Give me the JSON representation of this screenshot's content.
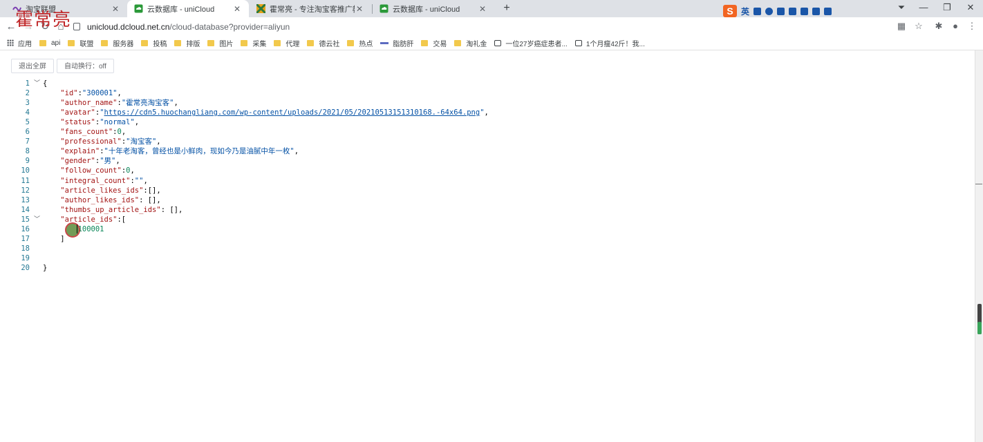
{
  "tabs": [
    {
      "title": "淘宝联盟",
      "active": false
    },
    {
      "title": "云数据库 - uniCloud",
      "active": true
    },
    {
      "title": "霍常亮 - 专注淘宝客推广教程分享",
      "active": false
    },
    {
      "title": "云数据库 - uniCloud",
      "active": false
    }
  ],
  "watermark": "霍常亮",
  "ime": {
    "label": "英"
  },
  "address": {
    "host": "unicloud.dcloud.net.cn",
    "path": "/cloud-database?provider=aliyun"
  },
  "bookmarks": [
    {
      "label": "应用",
      "icon": "apps-icon"
    },
    {
      "label": "api",
      "icon": "folder-icon"
    },
    {
      "label": "联盟",
      "icon": "folder-icon"
    },
    {
      "label": "服务器",
      "icon": "folder-icon"
    },
    {
      "label": "投稿",
      "icon": "folder-icon"
    },
    {
      "label": "排版",
      "icon": "folder-icon"
    },
    {
      "label": "图片",
      "icon": "folder-icon"
    },
    {
      "label": "采集",
      "icon": "folder-icon"
    },
    {
      "label": "代理",
      "icon": "folder-icon"
    },
    {
      "label": "德云社",
      "icon": "folder-icon"
    },
    {
      "label": "热点",
      "icon": "folder-icon"
    },
    {
      "label": "脂肪肝",
      "icon": "bar-icon"
    },
    {
      "label": "交易",
      "icon": "folder-icon"
    },
    {
      "label": "淘礼金",
      "icon": "folder-icon"
    },
    {
      "label": "一位27岁癌症患者...",
      "icon": "calendar-icon"
    },
    {
      "label": "1个月瘦42斤！我...",
      "icon": "calendar-icon"
    }
  ],
  "buttons": {
    "exit_fullscreen": "退出全屏",
    "word_wrap": "自动换行：off"
  },
  "editor": {
    "lines": [
      {
        "n": "1",
        "fold": true,
        "html": "{"
      },
      {
        "n": "2",
        "fold": false,
        "html": "    <span class='k'>\"id\"</span>:<span class='s'>\"300001\"</span>,"
      },
      {
        "n": "3",
        "fold": false,
        "html": "    <span class='k'>\"author_name\"</span>:<span class='s'>\"霍常亮淘宝客\"</span>,"
      },
      {
        "n": "4",
        "fold": false,
        "html": "    <span class='k'>\"avatar\"</span>:<span class='s'>\"</span><span class='u'>https://cdn5.huochangliang.com/wp-content/uploads/2021/05/20210513151310168.-64x64.png</span><span class='s'>\"</span>,"
      },
      {
        "n": "5",
        "fold": false,
        "html": "    <span class='k'>\"status\"</span>:<span class='s'>\"normal\"</span>,"
      },
      {
        "n": "6",
        "fold": false,
        "html": "    <span class='k'>\"fans_count\"</span>:<span class='n'>0</span>,"
      },
      {
        "n": "7",
        "fold": false,
        "html": "    <span class='k'>\"professional\"</span>:<span class='s'>\"淘宝客\"</span>,"
      },
      {
        "n": "8",
        "fold": false,
        "html": "    <span class='k'>\"explain\"</span>:<span class='s'>\"十年老淘客，曾经也是小鲜肉，现如今乃是油腻中年一枚\"</span>,"
      },
      {
        "n": "9",
        "fold": false,
        "html": "    <span class='k'>\"gender\"</span>:<span class='s'>\"男\"</span>,"
      },
      {
        "n": "10",
        "fold": false,
        "html": "    <span class='k'>\"follow_count\"</span>:<span class='n'>0</span>,"
      },
      {
        "n": "11",
        "fold": false,
        "html": "    <span class='k'>\"integral_count\"</span>:<span class='s'>\"\"</span>,"
      },
      {
        "n": "12",
        "fold": false,
        "html": "    <span class='k'>\"article_likes_ids\"</span>:[],"
      },
      {
        "n": "13",
        "fold": false,
        "html": "    <span class='k'>\"author_likes_ids\"</span>: [],"
      },
      {
        "n": "14",
        "fold": false,
        "html": "    <span class='k'>\"thumbs_up_article_ids\"</span>: [],"
      },
      {
        "n": "15",
        "fold": true,
        "html": "    <span class='k'>\"article_ids\"</span>:["
      },
      {
        "n": "16",
        "fold": false,
        "html": "        <span class='n'>100001</span>"
      },
      {
        "n": "17",
        "fold": false,
        "html": "    ]"
      },
      {
        "n": "18",
        "fold": false,
        "html": ""
      },
      {
        "n": "19",
        "fold": false,
        "html": ""
      },
      {
        "n": "20",
        "fold": false,
        "html": "}"
      }
    ]
  }
}
